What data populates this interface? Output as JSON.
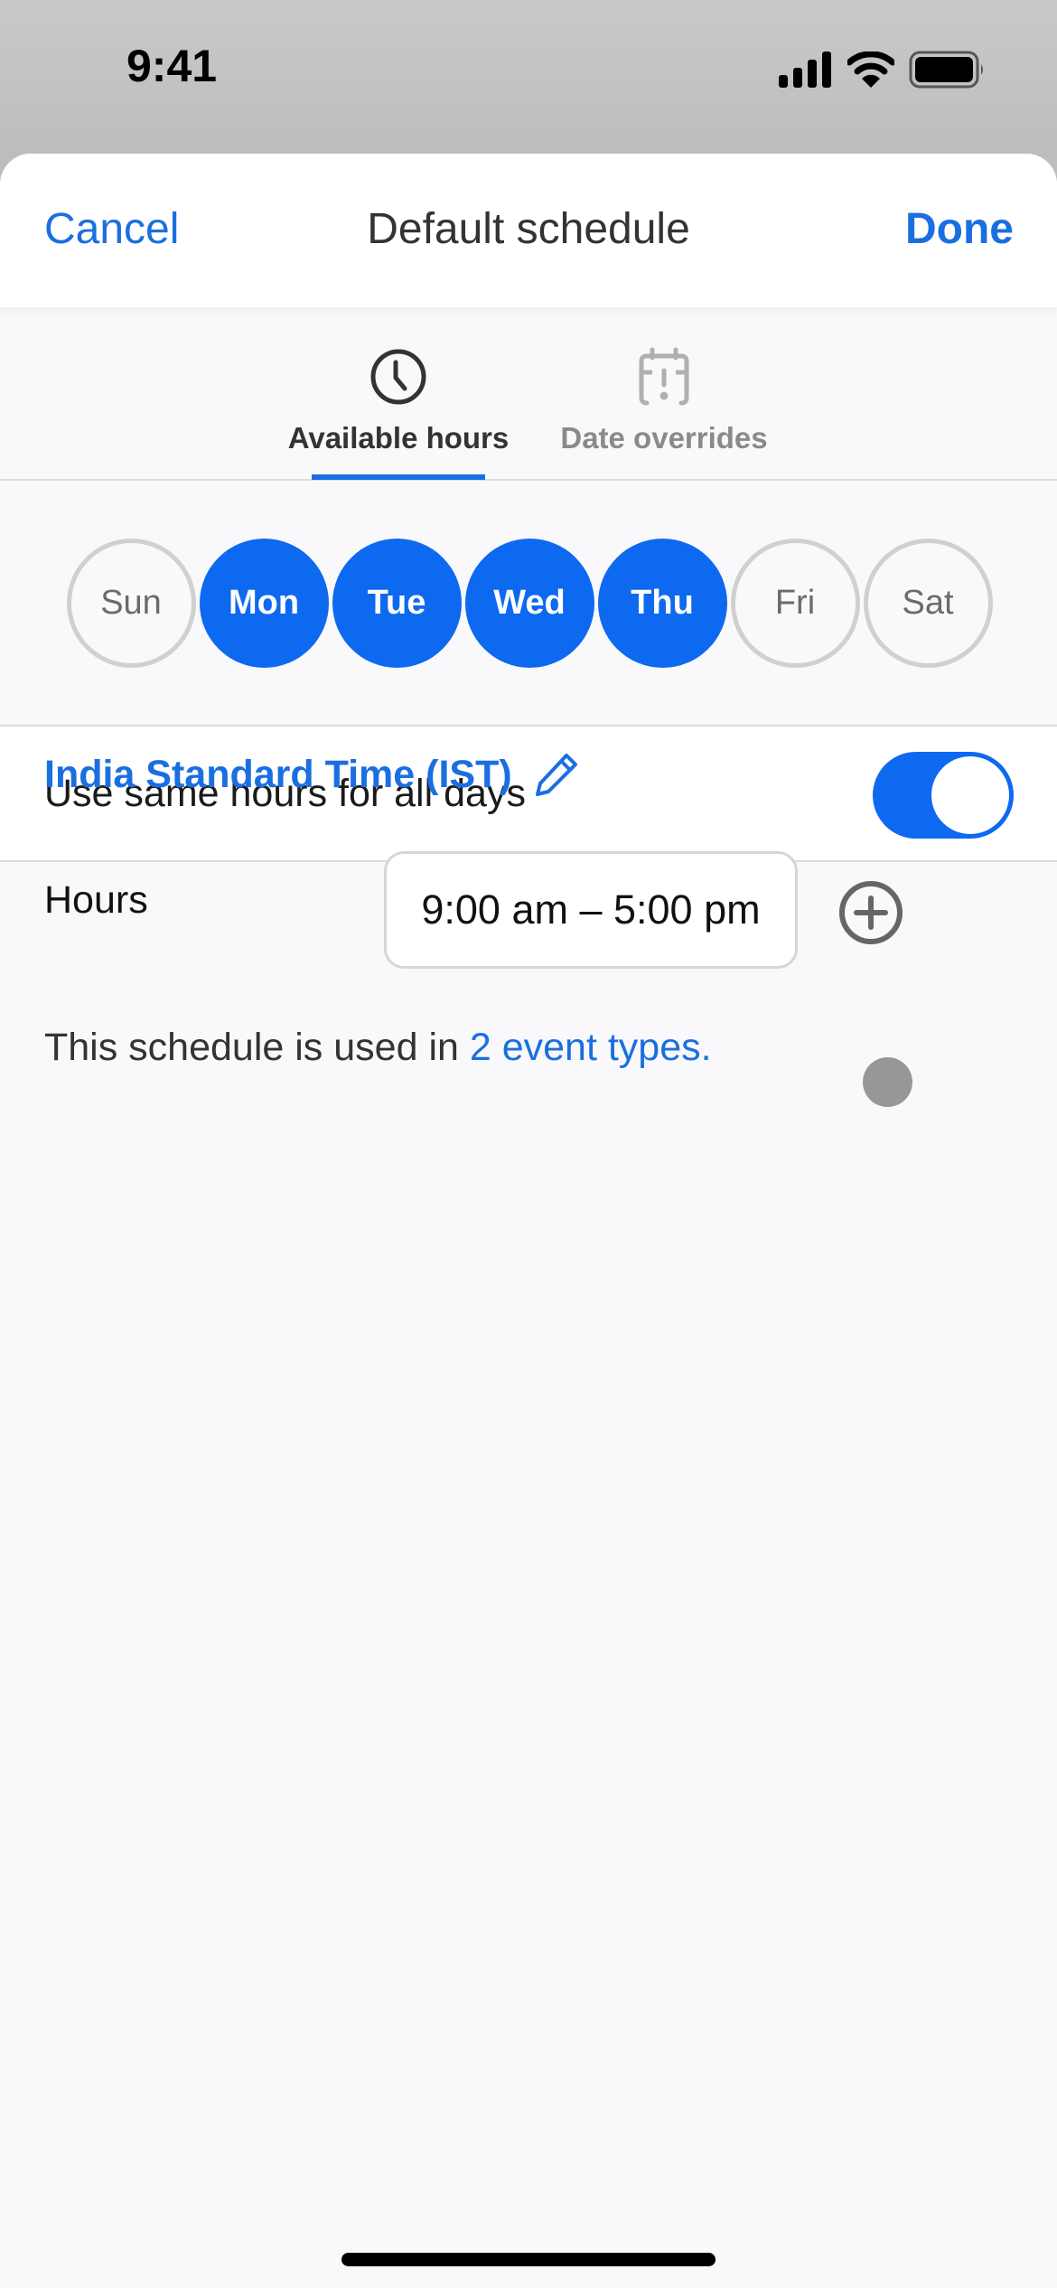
{
  "status_bar": {
    "time": "9:41",
    "icons": [
      "cellular-signal-icon",
      "wifi-icon",
      "battery-icon"
    ]
  },
  "nav": {
    "cancel_label": "Cancel",
    "title": "Default schedule",
    "done_label": "Done"
  },
  "tabs": [
    {
      "label": "Available hours",
      "icon": "clock-icon",
      "active": true
    },
    {
      "label": "Date overrides",
      "icon": "calendar-alert-icon",
      "active": false
    }
  ],
  "days": [
    {
      "label": "Sun",
      "selected": false
    },
    {
      "label": "Mon",
      "selected": true
    },
    {
      "label": "Tue",
      "selected": true
    },
    {
      "label": "Wed",
      "selected": true
    },
    {
      "label": "Thu",
      "selected": true
    },
    {
      "label": "Fri",
      "selected": false
    },
    {
      "label": "Sat",
      "selected": false
    }
  ],
  "same_hours": {
    "label": "Use same hours for all days",
    "enabled": true
  },
  "timezone": {
    "label": "India Standard Time (IST)",
    "edit_icon": "pencil-icon"
  },
  "hours": {
    "label": "Hours",
    "value": "9:00 am – 5:00 pm",
    "add_icon": "plus-circle-icon"
  },
  "usage": {
    "prefix": "This schedule is used in ",
    "link": "2 event types."
  },
  "colors": {
    "accent": "#0d69f0",
    "link": "#1a6fe0",
    "text": "#333333",
    "muted": "#8a8a8a"
  }
}
